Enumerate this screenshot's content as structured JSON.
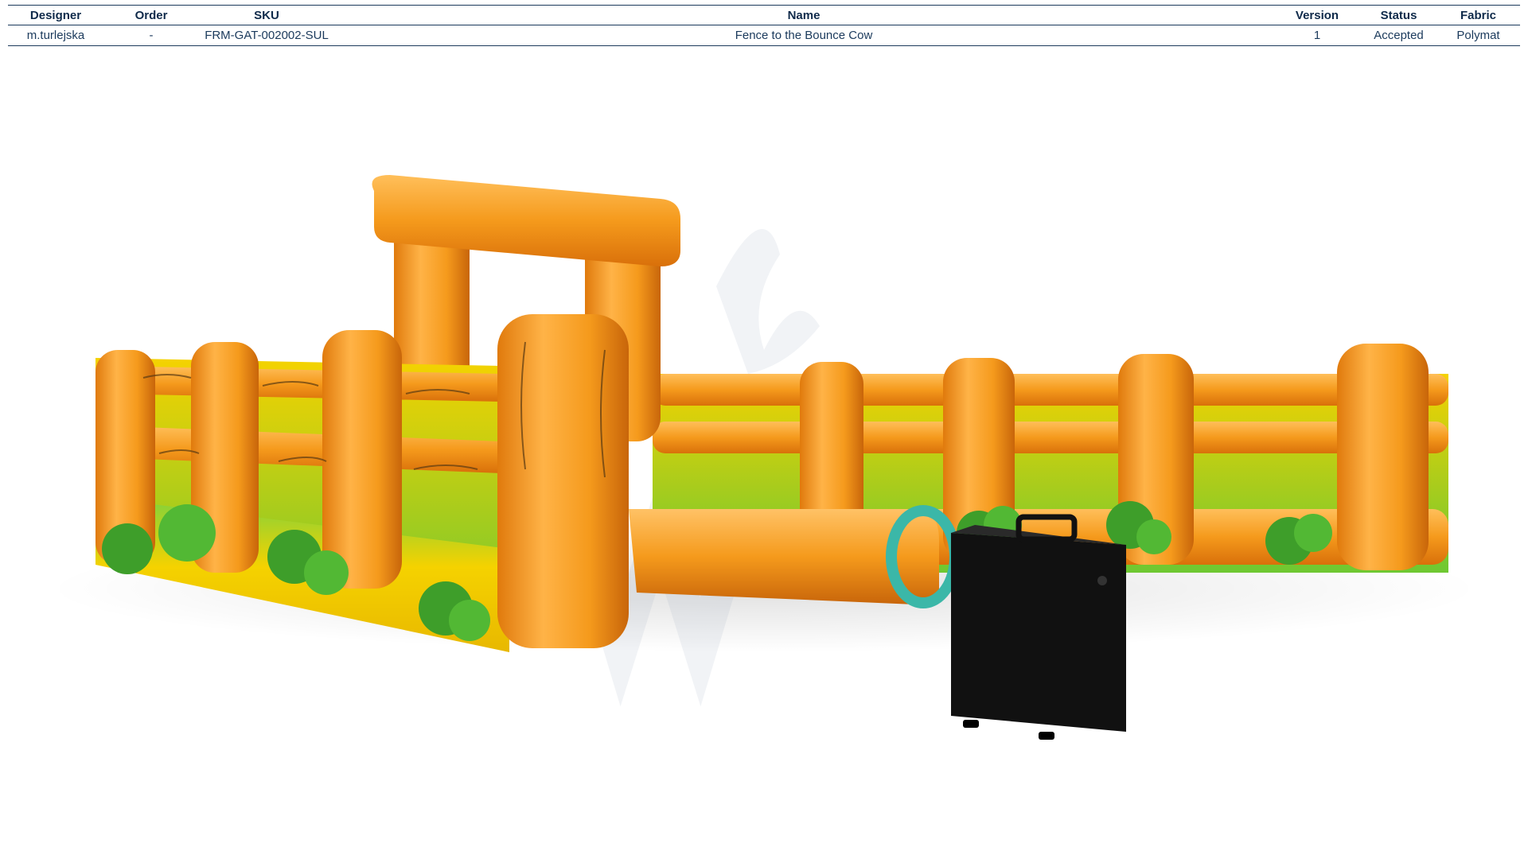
{
  "spec_table": {
    "headers": {
      "designer": "Designer",
      "order": "Order",
      "sku": "SKU",
      "name": "Name",
      "version": "Version",
      "status": "Status",
      "fabric": "Fabric"
    },
    "row": {
      "designer": "m.turlejska",
      "order": "-",
      "sku": "FRM-GAT-002002-SUL",
      "name": "Fence to the Bounce Cow",
      "version": "1",
      "status": "Accepted",
      "fabric": "Polymat"
    }
  },
  "render": {
    "subject": "inflatable-wooden-fence-arena",
    "colors": {
      "orange": "#f59a1c",
      "orange_dark": "#d9700a",
      "yellow": "#f5d200",
      "green": "#6ec832",
      "blower": "#111111",
      "cuff": "#3bb7a8"
    }
  }
}
